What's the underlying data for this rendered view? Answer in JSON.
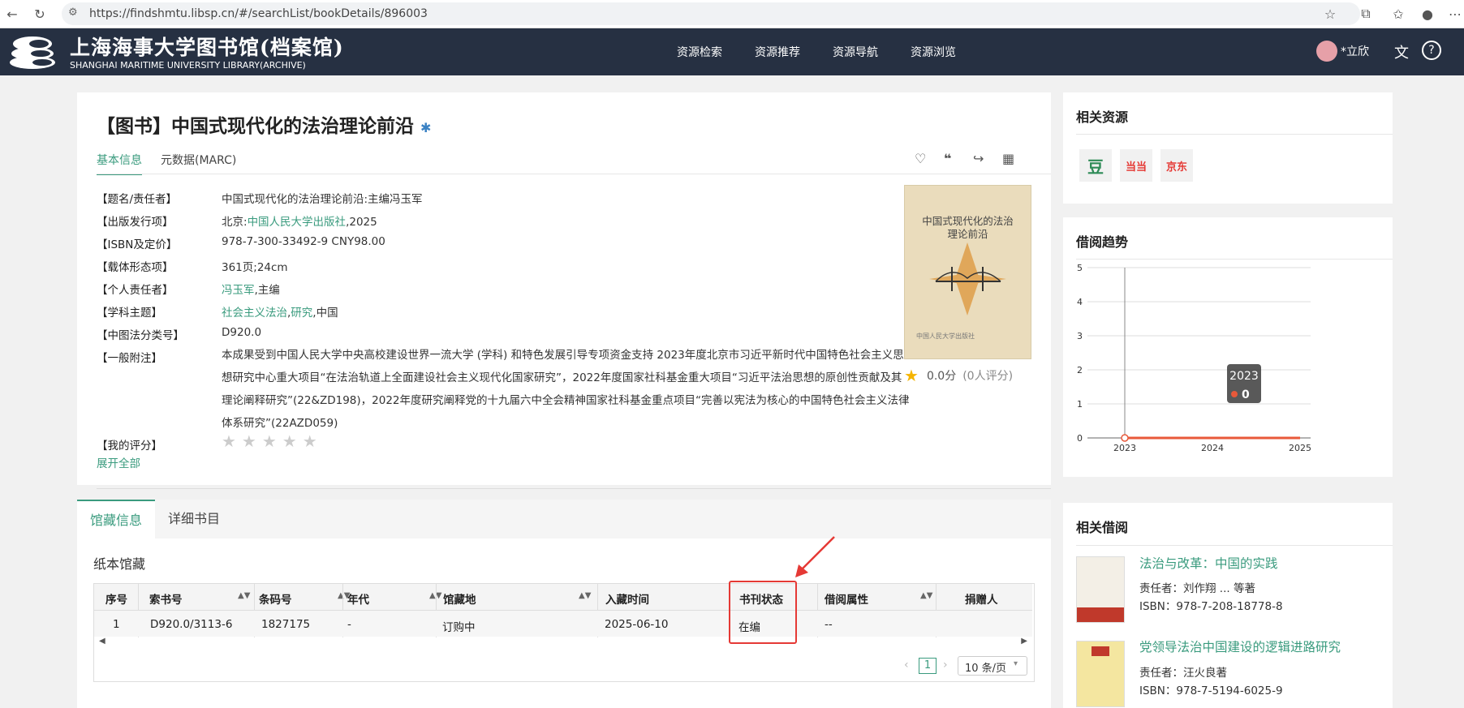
{
  "browser": {
    "url": "https://findshmtu.libsp.cn/#/searchList/bookDetails/896003"
  },
  "header": {
    "logo_cn": "上海海事大学图书馆(档案馆)",
    "logo_en": "SHANGHAI MARITIME UNIVERSITY LIBRARY(ARCHIVE)",
    "nav": [
      "资源检索",
      "资源推荐",
      "资源导航",
      "资源浏览"
    ],
    "user_name": "*立欣"
  },
  "book": {
    "title": "【图书】中国式现代化的法治理论前沿",
    "tabs": [
      "基本信息",
      "元数据(MARC)"
    ],
    "fields": {
      "title_resp_label": "【题名/责任者】",
      "title_resp_value": "中国式现代化的法治理论前沿:主编冯玉军",
      "pub_label": "【出版发行项】",
      "pub_prefix": "北京:",
      "pub_link": "中国人民大学出版社",
      "pub_year": ",2025",
      "isbn_label": "【ISBN及定价】",
      "isbn_value": "978-7-300-33492-9 CNY98.00",
      "carrier_label": "【载体形态项】",
      "carrier_value": "361页;24cm",
      "person_label": "【个人责任者】",
      "person_link": "冯玉军",
      "person_role": ",主编",
      "subject_label": "【学科主题】",
      "subject_link1": "社会主义法治",
      "subject_link2": "研究",
      "subject_rest": ",中国",
      "clc_label": "【中图法分类号】",
      "clc_value": "D920.0",
      "note_label": "【一般附注】",
      "note_value": "本成果受到中国人民大学中央高校建设世界一流大学 (学科) 和特色发展引导专项资金支持 2023年度北京市习近平新时代中国特色社会主义思想研究中心重大项目“在法治轨道上全面建设社会主义现代化国家研究”，2022年度国家社科基金重大项目“习近平法治思想的原创性贡献及其理论阐释研究”(22&ZD198)，2022年度研究阐释党的十九届六中全会精神国家社科基金重点项目“完善以宪法为核心的中国特色社会主义法律体系研究”(22AZD059)",
      "my_rating_label": "【我的评分】",
      "expand_all": "展开全部"
    },
    "cover_title": "中国式现代化的法治理论前沿",
    "cover_publisher": "中国人民大学出版社",
    "rating_score": "0.0分",
    "rating_count": "(0人评分)"
  },
  "holdings": {
    "tabs": [
      "馆藏信息",
      "详细书目"
    ],
    "section_title": "纸本馆藏",
    "columns": [
      "序号",
      "索书号",
      "条码号",
      "年代",
      "馆藏地",
      "入藏时间",
      "书刊状态",
      "借阅属性",
      "捐赠人"
    ],
    "rows": [
      [
        "1",
        "D920.0/3113-6",
        "1827175",
        "-",
        "订购中",
        "2025-06-10",
        "在编",
        "--",
        ""
      ]
    ],
    "page": "1",
    "page_size": "10 条/页"
  },
  "side": {
    "related_resources_title": "相关资源",
    "resource_labels": [
      "豆",
      "当当",
      "京东"
    ],
    "trend_title": "借阅趋势",
    "related_borrow_title": "相关借阅",
    "related": [
      {
        "title": "法治与改革：中国的实践",
        "author": "责任者：刘作翔 ... 等著",
        "isbn": "ISBN：978-7-208-18778-8"
      },
      {
        "title": "党领导法治中国建设的逻辑进路研究",
        "author": "责任者：汪火良著",
        "isbn": "ISBN：978-7-5194-6025-9"
      }
    ]
  },
  "chart_data": {
    "type": "line",
    "title": "借阅趋势",
    "x": [
      "2023",
      "2024",
      "2025"
    ],
    "series": [
      {
        "values": [
          0,
          0,
          0
        ]
      }
    ],
    "ylim": [
      0,
      5
    ],
    "yticks": [
      "0",
      "1",
      "2",
      "3",
      "4",
      "5"
    ],
    "tooltip": {
      "label": "2023",
      "value": "0"
    },
    "grid": true,
    "colors": {
      "line": "#e8593a",
      "grid": "#dddddd"
    }
  },
  "colors": {
    "accent": "#3a9b7e",
    "header_bg": "#263042",
    "highlight": "#e53935"
  }
}
